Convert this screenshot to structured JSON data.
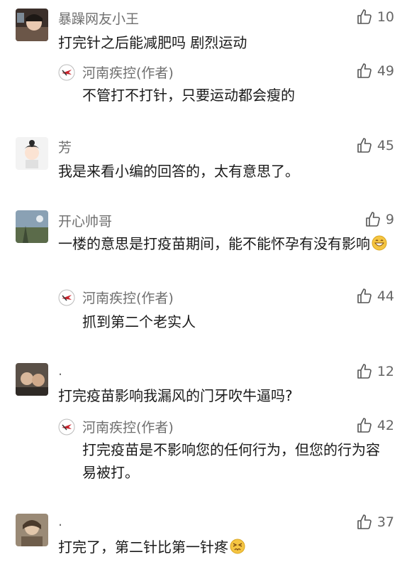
{
  "comments": [
    {
      "user": "暴躁网友小王",
      "text": "打完针之后能减肥吗 剧烈运动",
      "likes": "10",
      "reply": {
        "user": "河南疾控(作者)",
        "text": "不管打不打针，只要运动都会瘦的",
        "likes": "49"
      }
    },
    {
      "user": "芳",
      "text": "我是来看小编的回答的，太有意思了。",
      "likes": "45"
    },
    {
      "user": "开心帅哥",
      "text": "一楼的意思是打疫苗期间，能不能怀孕有没有影响",
      "emoji": "grin-emoji",
      "likes": "9",
      "reply": {
        "user": "河南疾控(作者)",
        "text": "抓到第二个老实人",
        "likes": "44"
      }
    },
    {
      "user": ".",
      "text": "打完疫苗影响我漏风的门牙吹牛逼吗?",
      "likes": "12",
      "reply": {
        "user": "河南疾控(作者)",
        "text": "打完疫苗是不影响您的任何行为，但您的行为容易被打。",
        "likes": "42"
      }
    },
    {
      "user": ".",
      "text": "打完了，第二针比第一针疼",
      "emoji": "persevering-face-emoji",
      "likes": "37"
    }
  ],
  "icons": {
    "like": "thumbs-up-outline-icon",
    "author_avatar": "henan-cdc-logo"
  },
  "colors": {
    "username": "#6f6f6f",
    "text": "#1a1a1a",
    "like": "#666666",
    "emoji": "#f5c542"
  }
}
